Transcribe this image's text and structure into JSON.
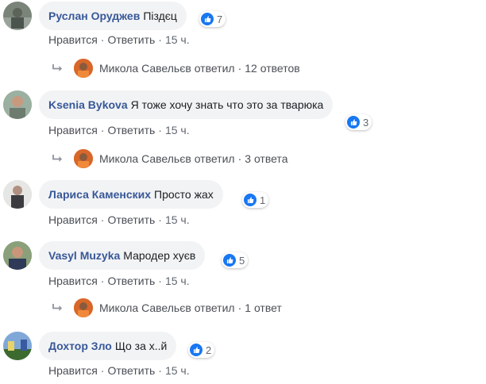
{
  "comments": [
    {
      "author": "Руслан Оруджев",
      "text": "Піздєц",
      "likes": "7",
      "like_label": "Нравится",
      "reply_label": "Ответить",
      "time": "15 ч.",
      "reply_summary": {
        "name": "Микола Савельєв",
        "verb": "ответил",
        "count": "12 ответов"
      }
    },
    {
      "author": "Ksenia Bykova",
      "text": "Я тоже хочу знать что это за тварюка",
      "likes": "3",
      "like_label": "Нравится",
      "reply_label": "Ответить",
      "time": "15 ч.",
      "reply_summary": {
        "name": "Микола Савельєв",
        "verb": "ответил",
        "count": "3 ответа"
      }
    },
    {
      "author": "Лариса Каменских",
      "text": "Просто жах",
      "likes": "1",
      "like_label": "Нравится",
      "reply_label": "Ответить",
      "time": "15 ч."
    },
    {
      "author": "Vasyl Muzyka",
      "text": "Мародер хуєв",
      "likes": "5",
      "like_label": "Нравится",
      "reply_label": "Ответить",
      "time": "15 ч.",
      "reply_summary": {
        "name": "Микола Савельєв",
        "verb": "ответил",
        "count": "1 ответ"
      }
    },
    {
      "author": "Дохтор Зло",
      "text": "Що за х..й",
      "likes": "2",
      "like_label": "Нравится",
      "reply_label": "Ответить",
      "time": "15 ч."
    }
  ],
  "dot": "·",
  "colors": {
    "author": "#385898",
    "like": "#1877f2",
    "bubble": "#f2f3f5"
  }
}
